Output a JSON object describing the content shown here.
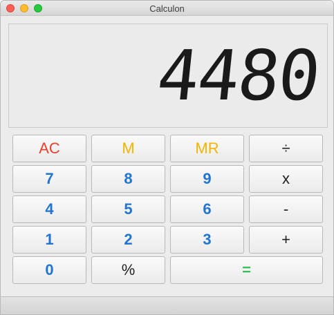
{
  "window": {
    "title": "Calculon"
  },
  "display": {
    "value": "4480"
  },
  "buttons": {
    "ac": "AC",
    "m": "M",
    "mr": "MR",
    "divide": "÷",
    "seven": "7",
    "eight": "8",
    "nine": "9",
    "multiply": "x",
    "four": "4",
    "five": "5",
    "six": "6",
    "subtract": "-",
    "one": "1",
    "two": "2",
    "three": "3",
    "add": "+",
    "zero": "0",
    "percent": "%",
    "equals": "="
  },
  "colors": {
    "clear": "#e8412d",
    "memory": "#f4b400",
    "digits": "#2174cf",
    "operators": "#222222",
    "equals": "#3bbf5a"
  }
}
